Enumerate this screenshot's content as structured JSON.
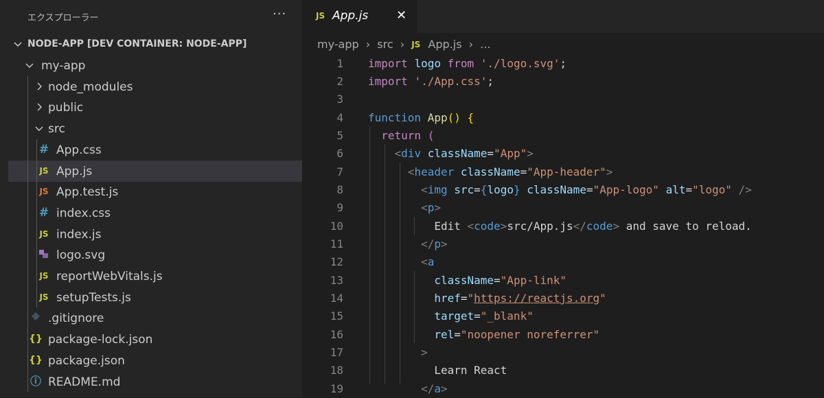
{
  "sidebar": {
    "title": "エクスプローラー",
    "more": "···",
    "section": "NODE-APP [DEV CONTAINER: NODE-APP]",
    "tree": [
      {
        "label": "my-app",
        "chev": "down",
        "icon": "",
        "depth": 1
      },
      {
        "label": "node_modules",
        "chev": "right",
        "icon": "",
        "depth": 2
      },
      {
        "label": "public",
        "chev": "right",
        "icon": "",
        "depth": 2
      },
      {
        "label": "src",
        "chev": "down",
        "icon": "",
        "depth": 2
      },
      {
        "label": "App.css",
        "chev": "",
        "icon": "#",
        "icon_name": "css-icon",
        "depth": 3
      },
      {
        "label": "App.js",
        "chev": "",
        "icon": "JS",
        "icon_name": "js-icon",
        "depth": 3,
        "active": true
      },
      {
        "label": "App.test.js",
        "chev": "",
        "icon": "JS",
        "icon_name": "test-js-icon",
        "depth": 3
      },
      {
        "label": "index.css",
        "chev": "",
        "icon": "#",
        "icon_name": "css-icon",
        "depth": 3
      },
      {
        "label": "index.js",
        "chev": "",
        "icon": "JS",
        "icon_name": "js-icon",
        "depth": 3
      },
      {
        "label": "logo.svg",
        "chev": "",
        "icon": "",
        "icon_name": "svg-icon",
        "depth": 3
      },
      {
        "label": "reportWebVitals.js",
        "chev": "",
        "icon": "JS",
        "icon_name": "js-icon",
        "depth": 3
      },
      {
        "label": "setupTests.js",
        "chev": "",
        "icon": "JS",
        "icon_name": "js-icon",
        "depth": 3
      },
      {
        "label": ".gitignore",
        "chev": "",
        "icon": "",
        "icon_name": "git-icon",
        "depth": 2
      },
      {
        "label": "package-lock.json",
        "chev": "",
        "icon": "{}",
        "icon_name": "json-icon",
        "depth": 2
      },
      {
        "label": "package.json",
        "chev": "",
        "icon": "{}",
        "icon_name": "json-icon",
        "depth": 2
      },
      {
        "label": "README.md",
        "chev": "",
        "icon": "ⓘ",
        "icon_name": "info-icon",
        "depth": 2
      }
    ]
  },
  "tab": {
    "icon": "JS",
    "label": "App.js",
    "close": "✕"
  },
  "breadcrumb": {
    "items": [
      "my-app",
      "src"
    ],
    "file_icon": "JS",
    "file": "App.js",
    "ellipsis": "..."
  },
  "code": {
    "lines": [
      "1",
      "2",
      "3",
      "4",
      "5",
      "6",
      "7",
      "8",
      "9",
      "10",
      "11",
      "12",
      "13",
      "14",
      "15",
      "16",
      "17",
      "18",
      "19"
    ]
  },
  "colors": {
    "keyword": "#c586c0",
    "tag": "#569cd6",
    "attr": "#9cdcfe",
    "string": "#ce9178",
    "function": "#dcdcaa",
    "js_icon": "#cbcb41",
    "css_icon": "#519aba"
  }
}
